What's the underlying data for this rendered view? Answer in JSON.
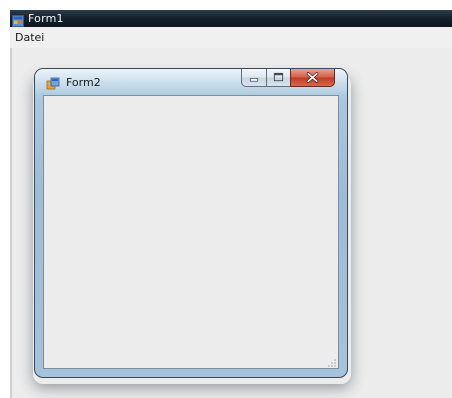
{
  "form1": {
    "title": "Form1",
    "icon": "app-window-icon",
    "menu": {
      "items": [
        {
          "label": "Datei"
        }
      ]
    }
  },
  "form2": {
    "title": "Form2",
    "icon": "app-window-icon",
    "caption_buttons": {
      "minimize": "minimize-icon",
      "maximize": "maximize-icon",
      "close": "close-icon"
    }
  },
  "colors": {
    "form1_titlebar": "#16222d",
    "client_background": "#ececec",
    "form2_frame": "#a9c8de",
    "close_button": "#c03c23"
  }
}
